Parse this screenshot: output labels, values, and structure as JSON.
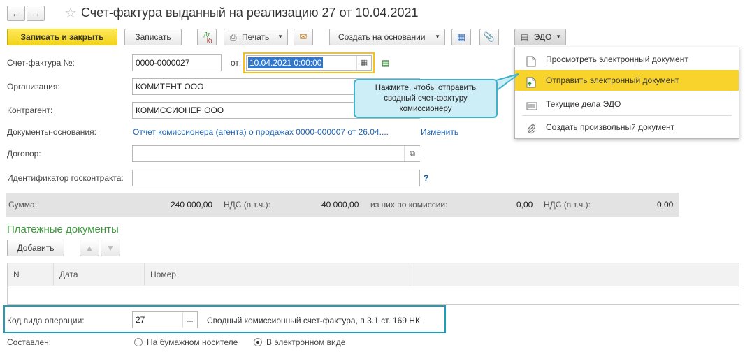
{
  "window": {
    "title": "Счет-фактура выданный на реализацию 27 от 10.04.2021"
  },
  "toolbar": {
    "save_close": "Записать и закрыть",
    "save": "Записать",
    "dtkt_top": "Дт",
    "dtkt_bottom": "Кт",
    "print": "Печать",
    "create_based": "Создать на основании",
    "edo": "ЭДО"
  },
  "form": {
    "invoice_label": "Счет-фактура №:",
    "invoice_number": "0000-0000027",
    "from_label": "от:",
    "date": "10.04.2021  0:00:00",
    "org_label": "Организация:",
    "org_value": "КОМИТЕНТ ООО",
    "contractor_label": "Контрагент:",
    "contractor_value": "КОМИССИОНЕР ООО",
    "basis_label": "Документы-основания:",
    "basis_link": "Отчет комиссионера (агента) о продажах 0000-000007 от 26.04....",
    "change_link": "Изменить",
    "contract_label": "Договор:",
    "contract_value": "",
    "gos_label": "Идентификатор госконтракта:",
    "gos_value": "",
    "help": "?"
  },
  "summary": {
    "sum_label": "Сумма:",
    "sum_value": "240 000,00",
    "vat_label": "НДС (в т.ч.):",
    "vat_value": "40 000,00",
    "commission_label": "из них по комиссии:",
    "commission_value": "0,00",
    "vat2_label": "НДС (в т.ч.):",
    "vat2_value": "0,00"
  },
  "payments": {
    "title": "Платежные документы",
    "add": "Добавить",
    "columns": [
      "N",
      "Дата",
      "Номер"
    ]
  },
  "operation": {
    "label": "Код вида операции:",
    "code": "27",
    "dots": "...",
    "description": "Сводный комиссионный счет-фактура, п.3.1 ст. 169 НК"
  },
  "composed": {
    "label": "Составлен:",
    "paper": "На бумажном носителе",
    "electronic": "В электронном виде"
  },
  "edo_menu": {
    "items": [
      "Просмотреть электронный документ",
      "Отправить электронный документ",
      "Текущие дела ЭДО",
      "Создать произвольный документ"
    ]
  },
  "tooltip": {
    "line1": "Нажмите, чтобы отправить",
    "line2": "сводный счет-фактуру",
    "line3": "комиссионеру"
  },
  "colors": {
    "accent_yellow": "#f6d11e",
    "highlight_teal": "#1f9db6",
    "link_blue": "#1a62b5",
    "section_green": "#3a9a3a"
  }
}
